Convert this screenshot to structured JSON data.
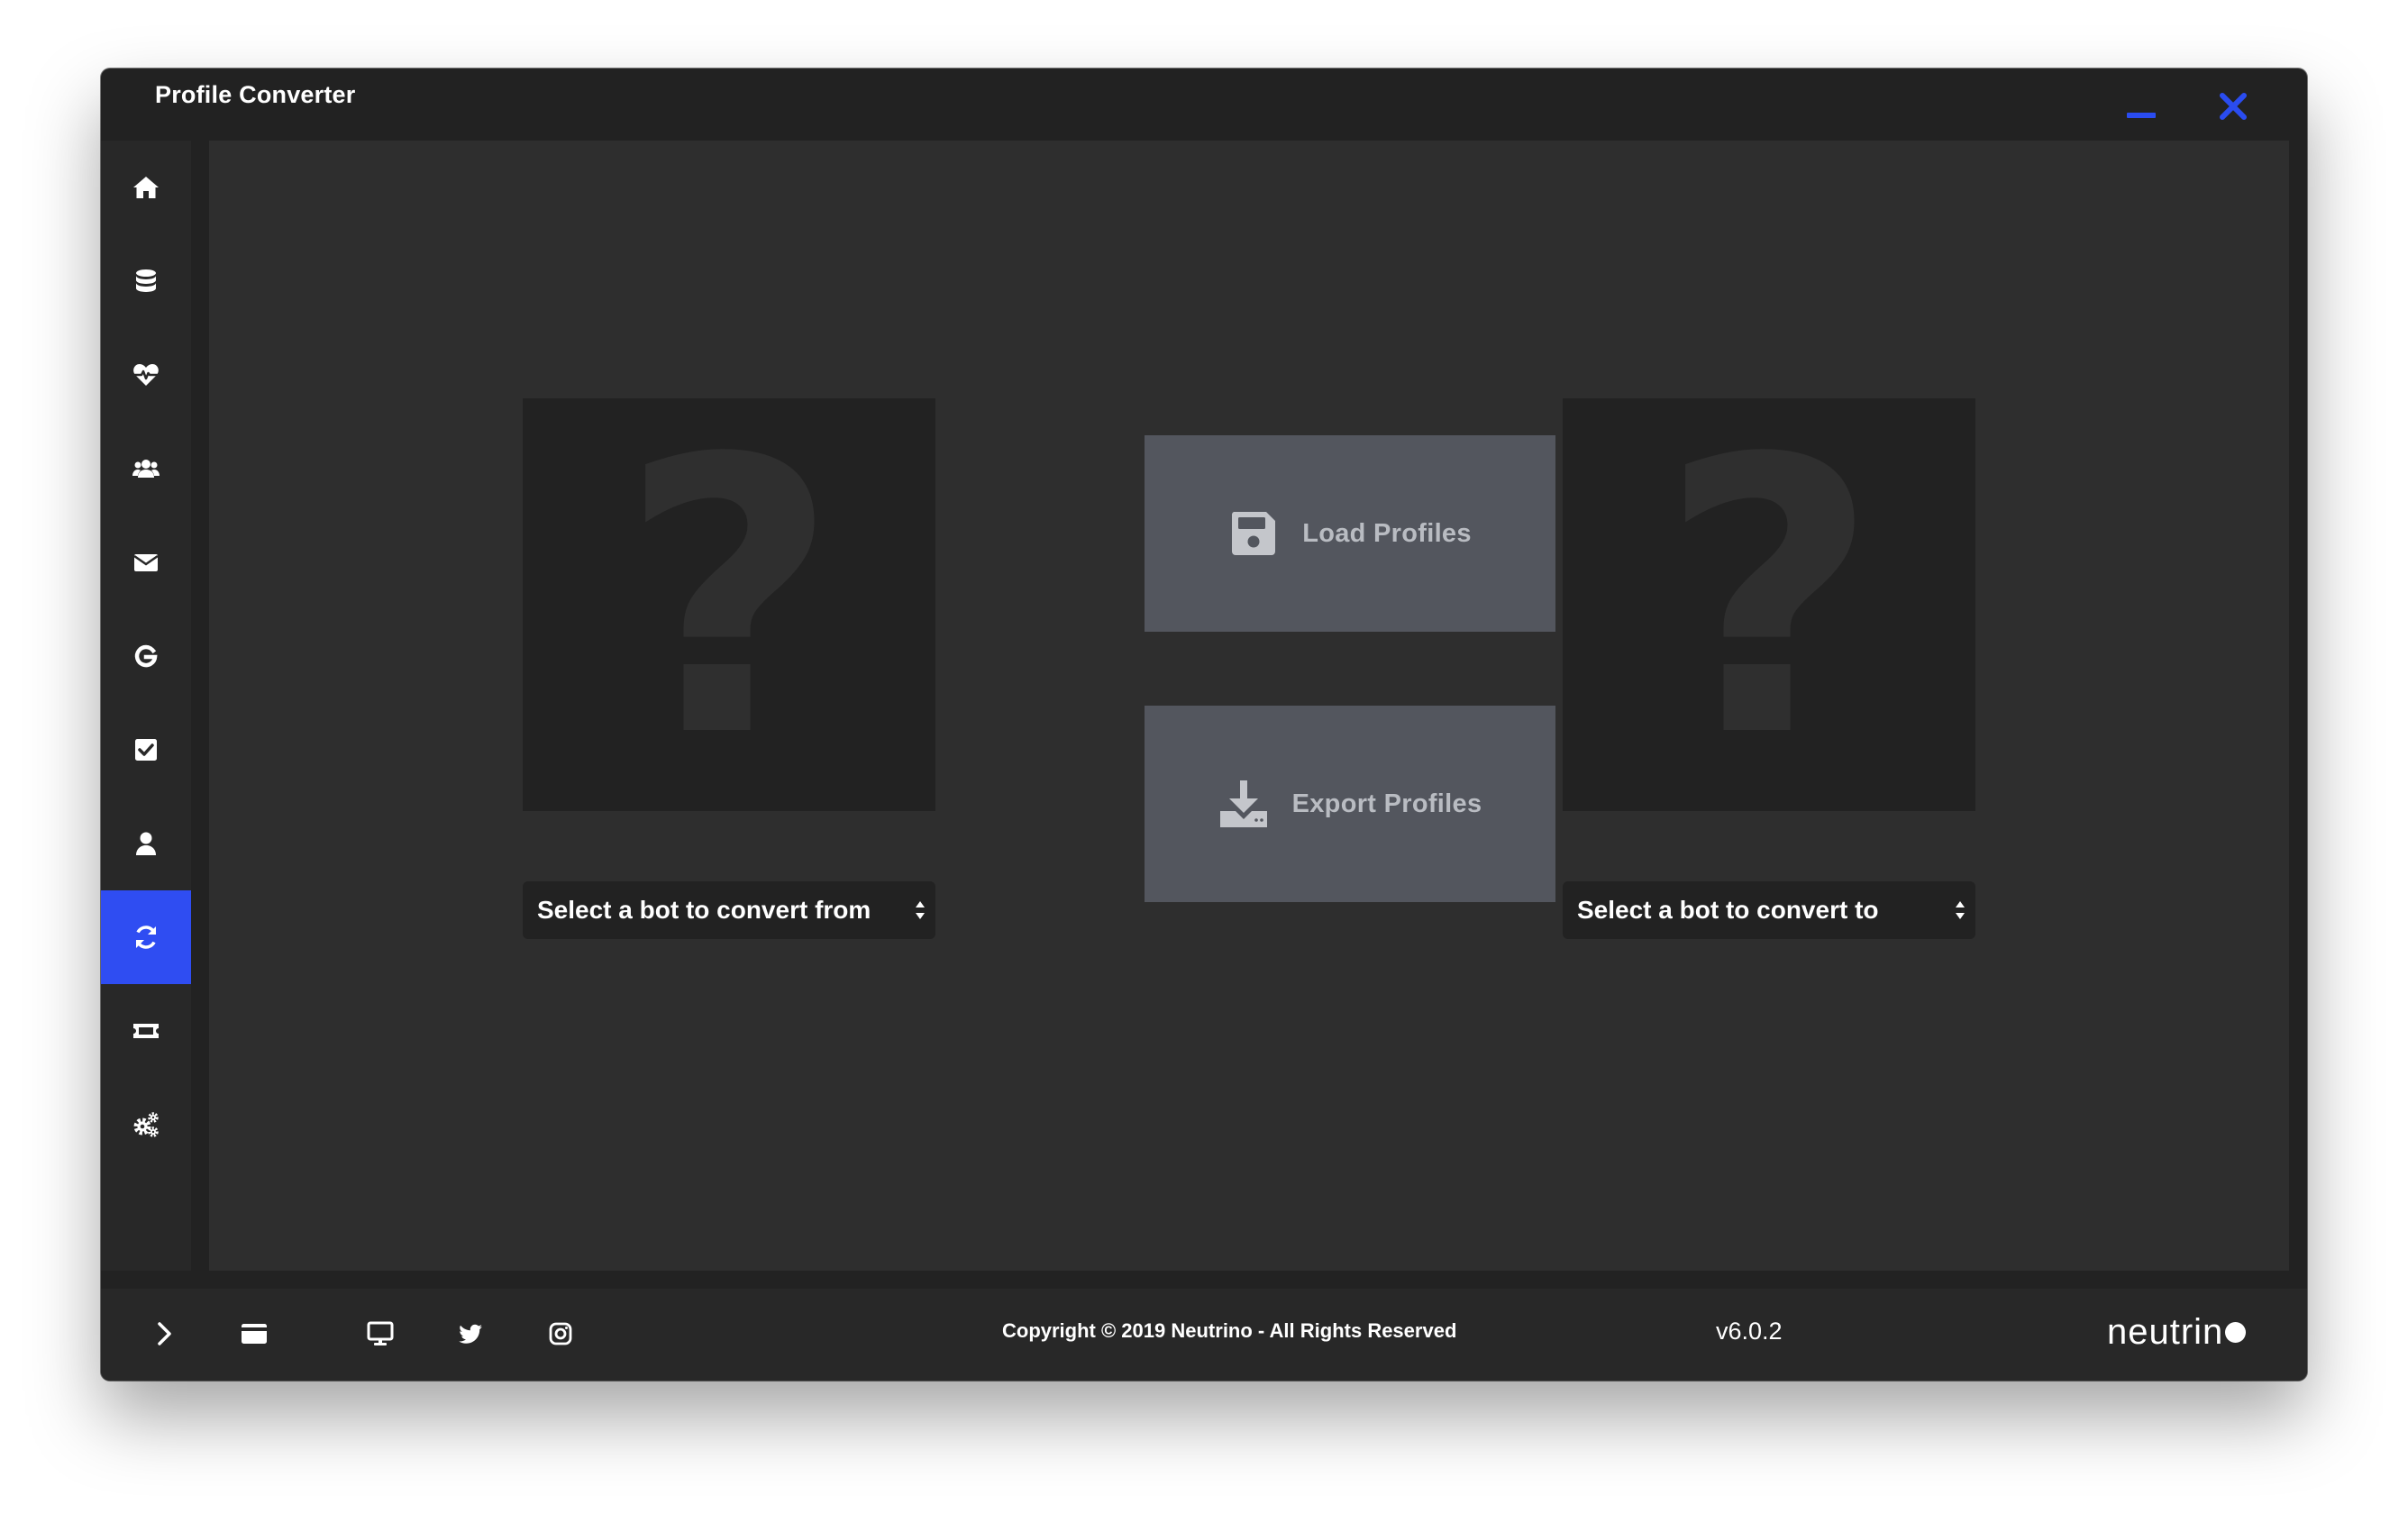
{
  "window": {
    "title": "Profile Converter"
  },
  "titlebar": {
    "accent_color": "#2f4df2"
  },
  "sidebar": {
    "items": [
      {
        "icon": "home-icon"
      },
      {
        "icon": "database-icon"
      },
      {
        "icon": "heartbeat-icon"
      },
      {
        "icon": "users-icon"
      },
      {
        "icon": "envelope-icon"
      },
      {
        "icon": "google-icon"
      },
      {
        "icon": "checkbox-icon"
      },
      {
        "icon": "user-icon"
      },
      {
        "icon": "sync-icon",
        "active": true
      },
      {
        "icon": "ticket-icon"
      },
      {
        "icon": "settings-icon"
      }
    ]
  },
  "main": {
    "source_placeholder": "?",
    "target_placeholder": "?",
    "load_button": "Load Profiles",
    "export_button": "Export Profiles",
    "source_select": "Select a bot to convert from",
    "target_select": "Select a bot to convert to"
  },
  "footer": {
    "icons": [
      "chevron-right-icon",
      "card-icon",
      "desktop-icon",
      "twitter-icon",
      "instagram-icon"
    ],
    "copyright": "Copyright © 2019 Neutrino - All Rights Reserved",
    "version": "v6.0.2",
    "brand": "neutrin"
  }
}
